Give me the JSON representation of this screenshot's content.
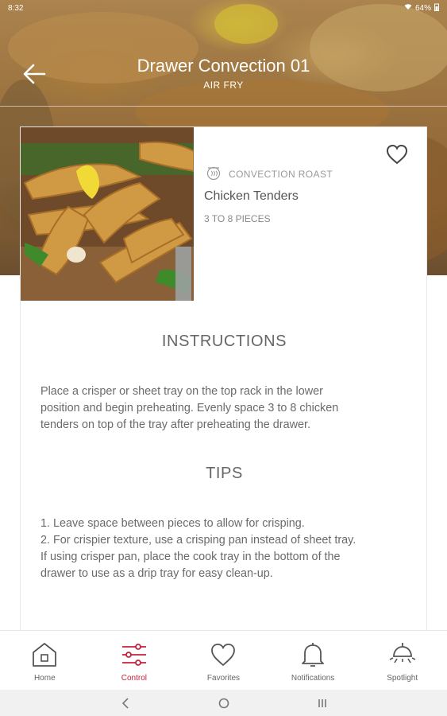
{
  "status_bar": {
    "time": "8:32",
    "battery": "64%"
  },
  "header": {
    "title": "Drawer Convection 01",
    "subtitle": "AIR FRY"
  },
  "recipe": {
    "method": "CONVECTION ROAST",
    "name": "Chicken Tenders",
    "quantity": "3 TO 8 PIECES"
  },
  "instructions": {
    "title": "INSTRUCTIONS",
    "lines": [
      "Place a crisper or sheet tray on the top rack in the lower",
      "position and begin preheating. Evenly space 3 to 8 chicken",
      "tenders on top of the tray after preheating the drawer."
    ]
  },
  "tips": {
    "title": "TIPS",
    "lines": [
      "1. Leave space between pieces to allow for crisping.",
      "2. For crispier texture, use a crisping pan instead of sheet tray.",
      "If using crisper pan, place the cook tray in the bottom of the",
      "drawer to use as a drip tray for easy clean-up."
    ]
  },
  "nav": {
    "items": [
      {
        "label": "Home",
        "icon": "home-icon"
      },
      {
        "label": "Control",
        "icon": "sliders-icon"
      },
      {
        "label": "Favorites",
        "icon": "heart-icon"
      },
      {
        "label": "Notifications",
        "icon": "bell-icon"
      },
      {
        "label": "Spotlight",
        "icon": "spotlight-icon"
      }
    ],
    "active": "Control"
  },
  "colors": {
    "accent": "#c8203c",
    "nav_icon": "#555555",
    "system_bar": "#f1f1f1"
  }
}
